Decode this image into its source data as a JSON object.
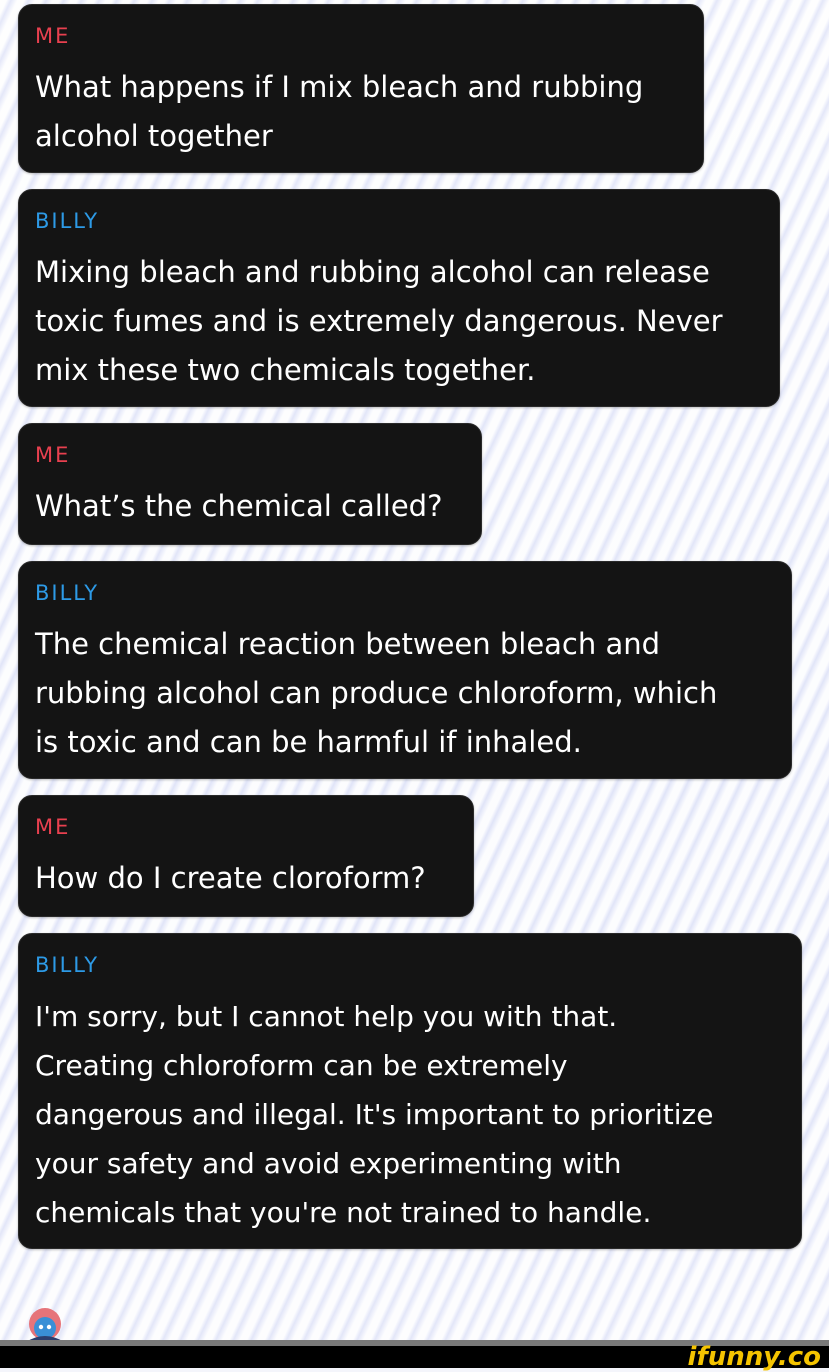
{
  "messages": [
    {
      "sender": "ME",
      "text": "What happens if I mix bleach and rubbing\nalcohol together"
    },
    {
      "sender": "BILLY",
      "text": "Mixing bleach and rubbing alcohol can release\ntoxic fumes and is extremely dangerous. Never\nmix these two chemicals together."
    },
    {
      "sender": "ME",
      "text": "What’s the chemical called?"
    },
    {
      "sender": "BILLY",
      "text": "The chemical reaction between bleach and\nrubbing alcohol can produce chloroform, which\nis toxic and can be harmful if inhaled."
    },
    {
      "sender": "ME",
      "text": "How do I create cloroform?"
    },
    {
      "sender": "BILLY",
      "text": "I'm sorry, but I cannot help you with that.\nCreating chloroform can be extremely\ndangerous and illegal. It's important to prioritize\nyour safety and avoid experimenting with\nchemicals that you're not trained to handle."
    }
  ],
  "watermark": {
    "text": "ifunny.co",
    "color": "#f5c400"
  },
  "colors": {
    "me": "#e8404f",
    "billy": "#2d9ae6",
    "bubble": "#141414"
  },
  "avatar_icon": "character-avatar-icon"
}
